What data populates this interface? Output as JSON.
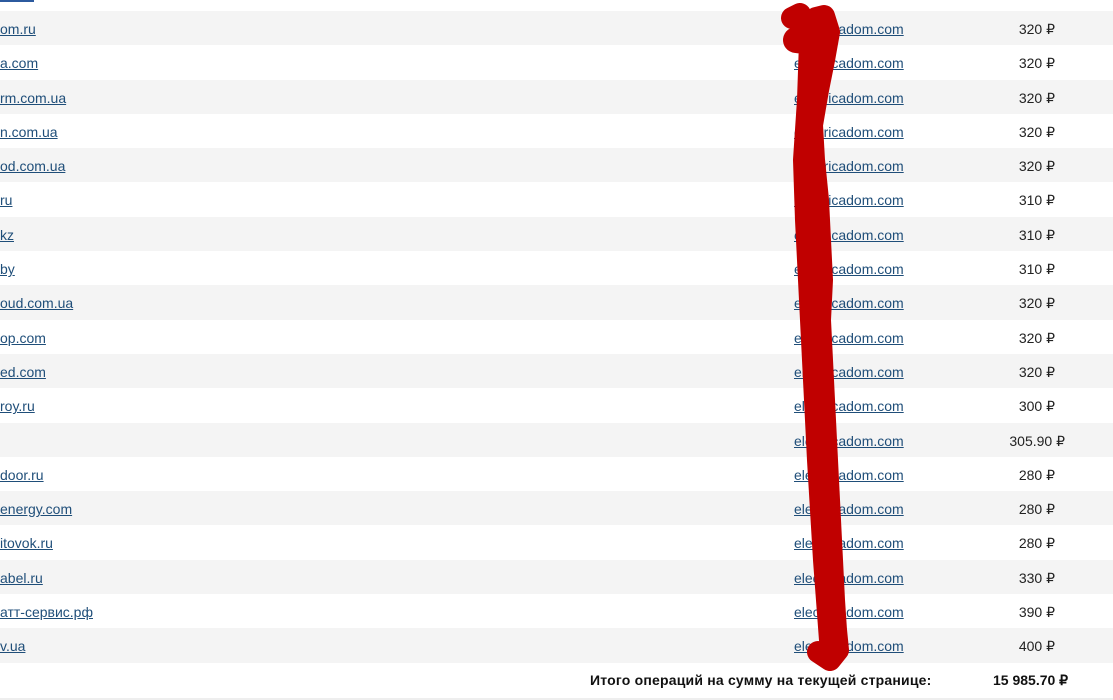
{
  "table": {
    "rows": [
      {
        "site": "om.ru",
        "domain": "electricadom.com",
        "price": "320 ₽"
      },
      {
        "site": "a.com",
        "domain": "electricadom.com",
        "price": "320 ₽"
      },
      {
        "site": "rm.com.ua",
        "domain": "electricadom.com",
        "price": "320 ₽"
      },
      {
        "site": "n.com.ua",
        "domain": "electricadom.com",
        "price": "320 ₽"
      },
      {
        "site": "od.com.ua",
        "domain": "electricadom.com",
        "price": "320 ₽"
      },
      {
        "site": "ru",
        "domain": "electricadom.com",
        "price": "310 ₽"
      },
      {
        "site": "kz",
        "domain": "electricadom.com",
        "price": "310 ₽"
      },
      {
        "site": "by",
        "domain": "electricadom.com",
        "price": "310 ₽"
      },
      {
        "site": "oud.com.ua",
        "domain": "electricadom.com",
        "price": "320 ₽"
      },
      {
        "site": "op.com",
        "domain": "electricadom.com",
        "price": "320 ₽"
      },
      {
        "site": "ed.com",
        "domain": "electricadom.com",
        "price": "320 ₽"
      },
      {
        "site": "roy.ru",
        "domain": "electricadom.com",
        "price": "300 ₽"
      },
      {
        "site": "",
        "domain": "electricadom.com",
        "price": "305.90 ₽"
      },
      {
        "site": "door.ru",
        "domain": "electricadom.com",
        "price": "280 ₽"
      },
      {
        "site": "energy.com",
        "domain": "electricadom.com",
        "price": "280 ₽"
      },
      {
        "site": "itovok.ru",
        "domain": "electricadom.com",
        "price": "280 ₽"
      },
      {
        "site": "abel.ru",
        "domain": "electricadom.com",
        "price": "330 ₽"
      },
      {
        "site": "атт-сервис.рф",
        "domain": "electricadom.com",
        "price": "390 ₽"
      },
      {
        "site": "v.ua",
        "domain": "electricadom.com",
        "price": "400 ₽"
      }
    ]
  },
  "summary": {
    "label": "Итого операций на сумму на текущей странице:",
    "value": "15 985.70 ₽"
  },
  "colors": {
    "link": "#1f4e79",
    "redaction": "#c00000",
    "row_alt": "#f4f4f4"
  }
}
